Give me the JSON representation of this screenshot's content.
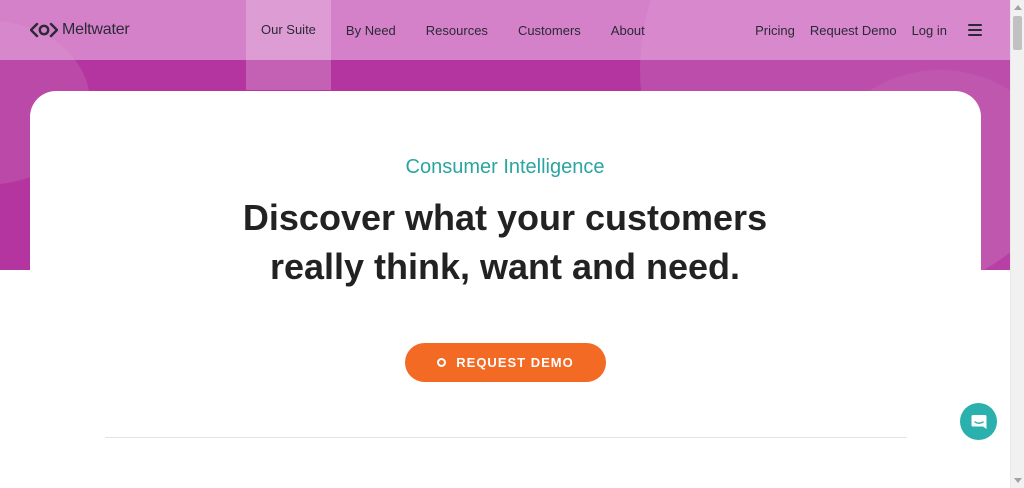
{
  "brand": {
    "name": "Meltwater",
    "logo_icon": "meltwater-logo-icon"
  },
  "nav": {
    "main": [
      {
        "label": "Our Suite"
      },
      {
        "label": "By Need"
      },
      {
        "label": "Resources"
      },
      {
        "label": "Customers"
      },
      {
        "label": "About"
      }
    ],
    "right": {
      "pricing": "Pricing",
      "request_demo": "Request Demo",
      "login": "Log in",
      "menu_icon": "hamburger-menu-icon"
    }
  },
  "hero": {
    "eyebrow": "Consumer Intelligence",
    "headline_line1": "Discover what your customers",
    "headline_line2": "really think, want and need.",
    "cta_label": "REQUEST DEMO"
  },
  "chat": {
    "icon": "chat-bubble-icon"
  },
  "colors": {
    "hero_background": "#b4359f",
    "header_overlay": "#e2a0da",
    "eyebrow": "#2aa5a0",
    "cta": "#f26a24",
    "chat": "#2ab0ad",
    "headline": "#222222"
  }
}
